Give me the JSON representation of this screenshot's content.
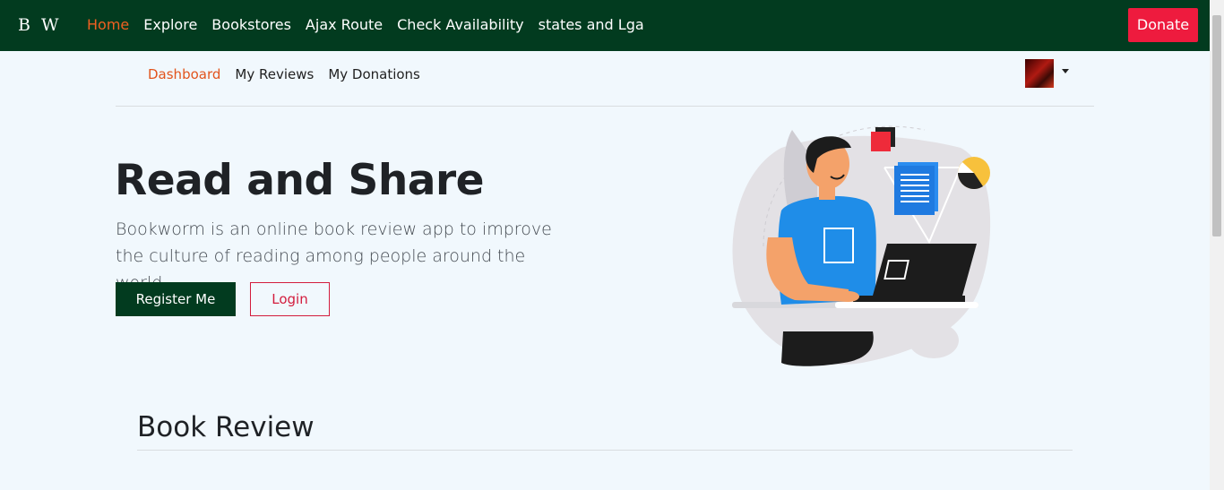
{
  "brand": {
    "logo": "B W"
  },
  "nav": {
    "items": [
      "Home",
      "Explore",
      "Bookstores",
      "Ajax Route",
      "Check Availability",
      "states and Lga"
    ],
    "active": "Home",
    "donate_label": "Donate"
  },
  "subnav": {
    "items": [
      "Dashboard",
      "My Reviews",
      "My Donations"
    ],
    "active": "Dashboard"
  },
  "hero": {
    "title": "Read and Share",
    "text": "Bookworm is an online book review app to improve the culture of reading among people around the world.",
    "register_label": "Register Me",
    "login_label": "Login"
  },
  "section": {
    "title": "Book Review"
  },
  "colors": {
    "navbar": "#023b1f",
    "accent": "#f06021",
    "donate": "#ee1b3e",
    "background": "#f1f8fd"
  },
  "icons": {
    "avatar": "user-avatar",
    "dropdown": "caret-down-icon",
    "illustration": "man-with-laptop-illustration"
  }
}
